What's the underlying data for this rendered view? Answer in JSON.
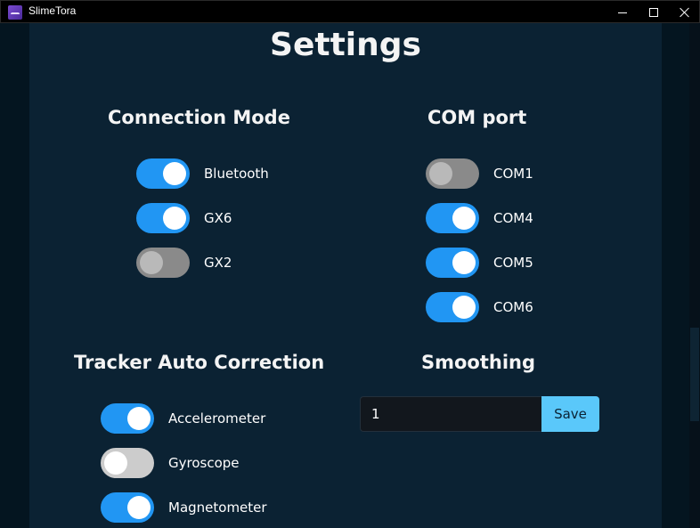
{
  "window": {
    "title": "SlimeTora",
    "app_icon": "slimetora-logo-icon",
    "controls": {
      "minimize": "minimize-icon",
      "maximize": "maximize-icon",
      "close": "close-icon"
    }
  },
  "page": {
    "title": "Settings"
  },
  "connection_mode": {
    "title": "Connection Mode",
    "items": [
      {
        "label": "Bluetooth",
        "enabled": true
      },
      {
        "label": "GX6",
        "enabled": true
      },
      {
        "label": "GX2",
        "enabled": false
      }
    ]
  },
  "com_port": {
    "title": "COM port",
    "items": [
      {
        "label": "COM1",
        "enabled": false
      },
      {
        "label": "COM4",
        "enabled": true
      },
      {
        "label": "COM5",
        "enabled": true
      },
      {
        "label": "COM6",
        "enabled": true
      }
    ]
  },
  "tracker_auto_correction": {
    "title": "Tracker Auto Correction",
    "items": [
      {
        "label": "Accelerometer",
        "enabled": true
      },
      {
        "label": "Gyroscope",
        "enabled": false
      },
      {
        "label": "Magnetometer",
        "enabled": true
      }
    ]
  },
  "smoothing": {
    "title": "Smoothing",
    "value": "1",
    "save_label": "Save"
  },
  "colors": {
    "toggle_on": "#2196f3",
    "toggle_off": "#8a8a8a",
    "save_button": "#5ac8fa",
    "panel_background": "#0b2233"
  }
}
